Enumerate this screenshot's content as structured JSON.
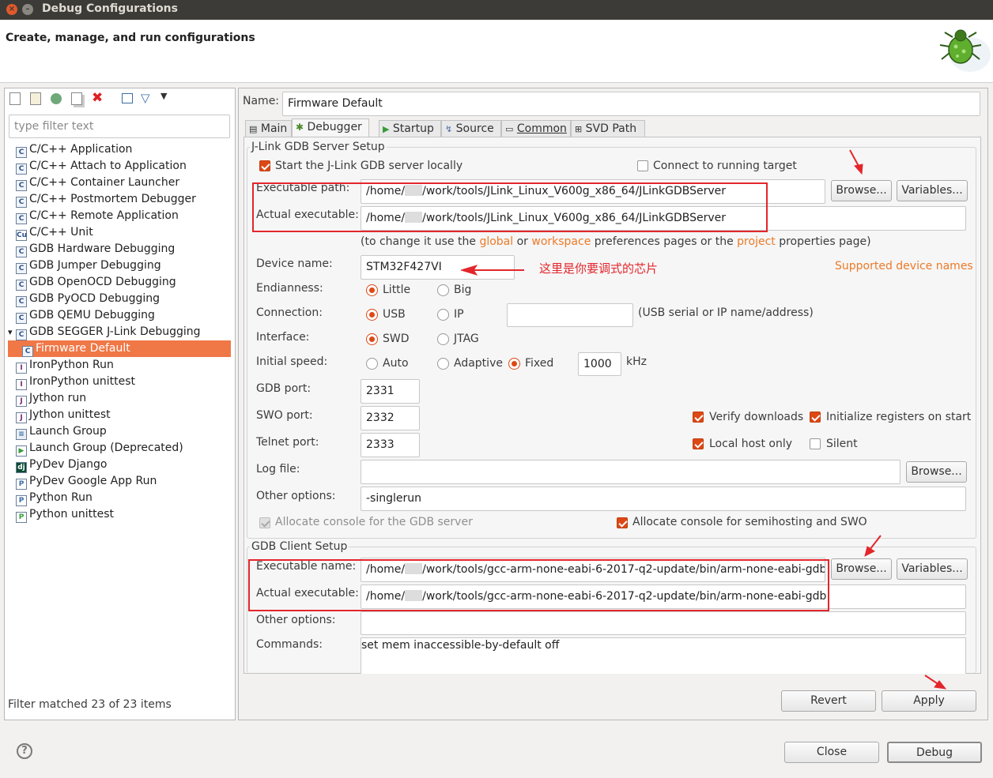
{
  "window": {
    "title": "Debug Configurations"
  },
  "header": {
    "subtitle": "Create, manage, and run configurations",
    "icon": "bug-icon"
  },
  "left": {
    "filter_placeholder": "type filter text",
    "toolbar_icons": [
      "new-config-icon",
      "new-prototype-icon",
      "export-icon",
      "duplicate-icon",
      "delete-icon",
      "collapse-all-icon",
      "filter-icon",
      "view-menu-icon"
    ],
    "items": [
      {
        "label": "C/C++ Application",
        "icon": "c-icon"
      },
      {
        "label": "C/C++ Attach to Application",
        "icon": "c-icon"
      },
      {
        "label": "C/C++ Container Launcher",
        "icon": "c-icon"
      },
      {
        "label": "C/C++ Postmortem Debugger",
        "icon": "c-icon"
      },
      {
        "label": "C/C++ Remote Application",
        "icon": "c-icon"
      },
      {
        "label": "C/C++ Unit",
        "icon": "cu-icon"
      },
      {
        "label": "GDB Hardware Debugging",
        "icon": "c-icon"
      },
      {
        "label": "GDB Jumper Debugging",
        "icon": "c-icon"
      },
      {
        "label": "GDB OpenOCD Debugging",
        "icon": "c-icon"
      },
      {
        "label": "GDB PyOCD Debugging",
        "icon": "c-icon"
      },
      {
        "label": "GDB QEMU Debugging",
        "icon": "c-icon"
      },
      {
        "label": "GDB SEGGER J-Link Debugging",
        "icon": "c-icon"
      },
      {
        "label": "Firmware Default",
        "icon": "c-icon"
      },
      {
        "label": "IronPython Run",
        "icon": "ironpython-icon"
      },
      {
        "label": "IronPython unittest",
        "icon": "ironpython-unittest-icon"
      },
      {
        "label": "Jython run",
        "icon": "jython-icon"
      },
      {
        "label": "Jython unittest",
        "icon": "jython-unittest-icon"
      },
      {
        "label": "Launch Group",
        "icon": "launch-group-icon"
      },
      {
        "label": "Launch Group (Deprecated)",
        "icon": "run-icon"
      },
      {
        "label": "PyDev Django",
        "icon": "django-icon"
      },
      {
        "label": "PyDev Google App Run",
        "icon": "python-icon"
      },
      {
        "label": "Python Run",
        "icon": "python-icon"
      },
      {
        "label": "Python unittest",
        "icon": "python-unittest-icon"
      }
    ],
    "status": "Filter matched 23 of 23 items"
  },
  "name": {
    "label": "Name:",
    "value": "Firmware Default"
  },
  "tabs": [
    {
      "label": "Main",
      "icon": "main-icon"
    },
    {
      "label": "Debugger",
      "icon": "debugger-icon"
    },
    {
      "label": "Startup",
      "icon": "startup-icon"
    },
    {
      "label": "Source",
      "icon": "source-icon"
    },
    {
      "label": "Common",
      "icon": "common-icon"
    },
    {
      "label": "SVD Path",
      "icon": "svd-icon"
    }
  ],
  "server": {
    "group_title": "J-Link GDB Server Setup",
    "start_locally": "Start the J-Link GDB server locally",
    "connect_running": "Connect to running target",
    "exec_path_label": "Executable path:",
    "exec_path_pre": "/home/",
    "exec_path_post": "/work/tools/JLink_Linux_V600g_x86_64/JLinkGDBServer",
    "actual_label": "Actual executable:",
    "actual_pre": "/home/",
    "actual_post": "/work/tools/JLink_Linux_V600g_x86_64/JLinkGDBServer",
    "browse": "Browse...",
    "variables": "Variables...",
    "hint_1": "(to change it use the ",
    "hint_global": "global",
    "hint_or": " or ",
    "hint_workspace": "workspace",
    "hint_mid": " preferences pages or the ",
    "hint_project": "project",
    "hint_end": " properties page)",
    "device_label": "Device name:",
    "device_value": "STM32F427VI",
    "annotation": "这里是你要调式的芯片",
    "supported": "Supported device names",
    "endian_label": "Endianness:",
    "little": "Little",
    "big": "Big",
    "conn_label": "Connection:",
    "usb": "USB",
    "ip": "IP",
    "conn_hint": "(USB serial or IP name/address)",
    "iface_label": "Interface:",
    "swd": "SWD",
    "jtag": "JTAG",
    "speed_label": "Initial speed:",
    "auto": "Auto",
    "adaptive": "Adaptive",
    "fixed": "Fixed",
    "speed_value": "1000",
    "khz": "kHz",
    "gdb_port_label": "GDB port:",
    "gdb_port": "2331",
    "swo_port_label": "SWO port:",
    "swo_port": "2332",
    "telnet_label": "Telnet port:",
    "telnet_port": "2333",
    "verify": "Verify downloads",
    "init_regs": "Initialize registers on start",
    "localhost": "Local host only",
    "silent": "Silent",
    "log_label": "Log file:",
    "other_label": "Other options:",
    "other_value": "-singlerun",
    "alloc_gdb": "Allocate console for the GDB server",
    "alloc_semi": "Allocate console for semihosting and SWO"
  },
  "client": {
    "group_title": "GDB Client Setup",
    "exec_label": "Executable name:",
    "exec_pre": "/home/",
    "exec_post": "/work/tools/gcc-arm-none-eabi-6-2017-q2-update/bin/arm-none-eabi-gdb",
    "actual_label": "Actual executable:",
    "actual_pre": "/home/",
    "actual_post": "/work/tools/gcc-arm-none-eabi-6-2017-q2-update/bin/arm-none-eabi-gdb",
    "browse": "Browse...",
    "variables": "Variables...",
    "other_label": "Other options:",
    "commands_label": "Commands:",
    "commands_value": "set mem inaccessible-by-default off"
  },
  "buttons": {
    "revert": "Revert",
    "apply": "Apply",
    "close": "Close",
    "debug": "Debug",
    "help_icon": "help-icon"
  },
  "colors": {
    "accent": "#dd4814",
    "link": "#ec7a27",
    "highlight": "#e3262c",
    "selection": "#f07746"
  }
}
